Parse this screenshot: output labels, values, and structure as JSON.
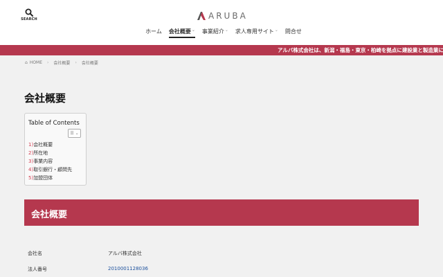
{
  "header": {
    "search_label": "SEARCH",
    "logo_text": "ARUBA",
    "nav": [
      {
        "label": "ホーム"
      },
      {
        "label": "会社概要",
        "has_dropdown": true,
        "active": true
      },
      {
        "label": "事業紹介",
        "has_dropdown": true
      },
      {
        "label": "求人専用サイト",
        "has_dropdown": true
      },
      {
        "label": "問合せ"
      }
    ],
    "dropdown_glyph": "⌄"
  },
  "ticker": {
    "text": "アルバ株式会社は、新潟・福島・東京・柏崎を拠点に建設業と製造業に特化"
  },
  "breadcrumb": {
    "home": "HOME",
    "items": [
      "会社概要",
      "会社概要"
    ],
    "separator": "›",
    "home_icon": "⌂"
  },
  "page": {
    "title": "会社概要"
  },
  "toc": {
    "title": "Table of Contents",
    "toggle_glyph": "☰ ⌄",
    "items": [
      {
        "num": "1)",
        "label": "会社概要"
      },
      {
        "num": "2)",
        "label": "所在地"
      },
      {
        "num": "3)",
        "label": "事業内容"
      },
      {
        "num": "4)",
        "label": "取引銀行・顧問先"
      },
      {
        "num": "5)",
        "label": "加盟団体"
      }
    ]
  },
  "section": {
    "title": "会社概要"
  },
  "company_info": [
    {
      "label": "会社名",
      "value": "アルバ株式会社"
    },
    {
      "label": "法人番号",
      "value": "2010001128036",
      "link": true
    }
  ],
  "colors": {
    "accent": "#b5384e",
    "toc_number": "#d33c4f",
    "link": "#1a4f9c",
    "background": "#f1f1f1"
  }
}
